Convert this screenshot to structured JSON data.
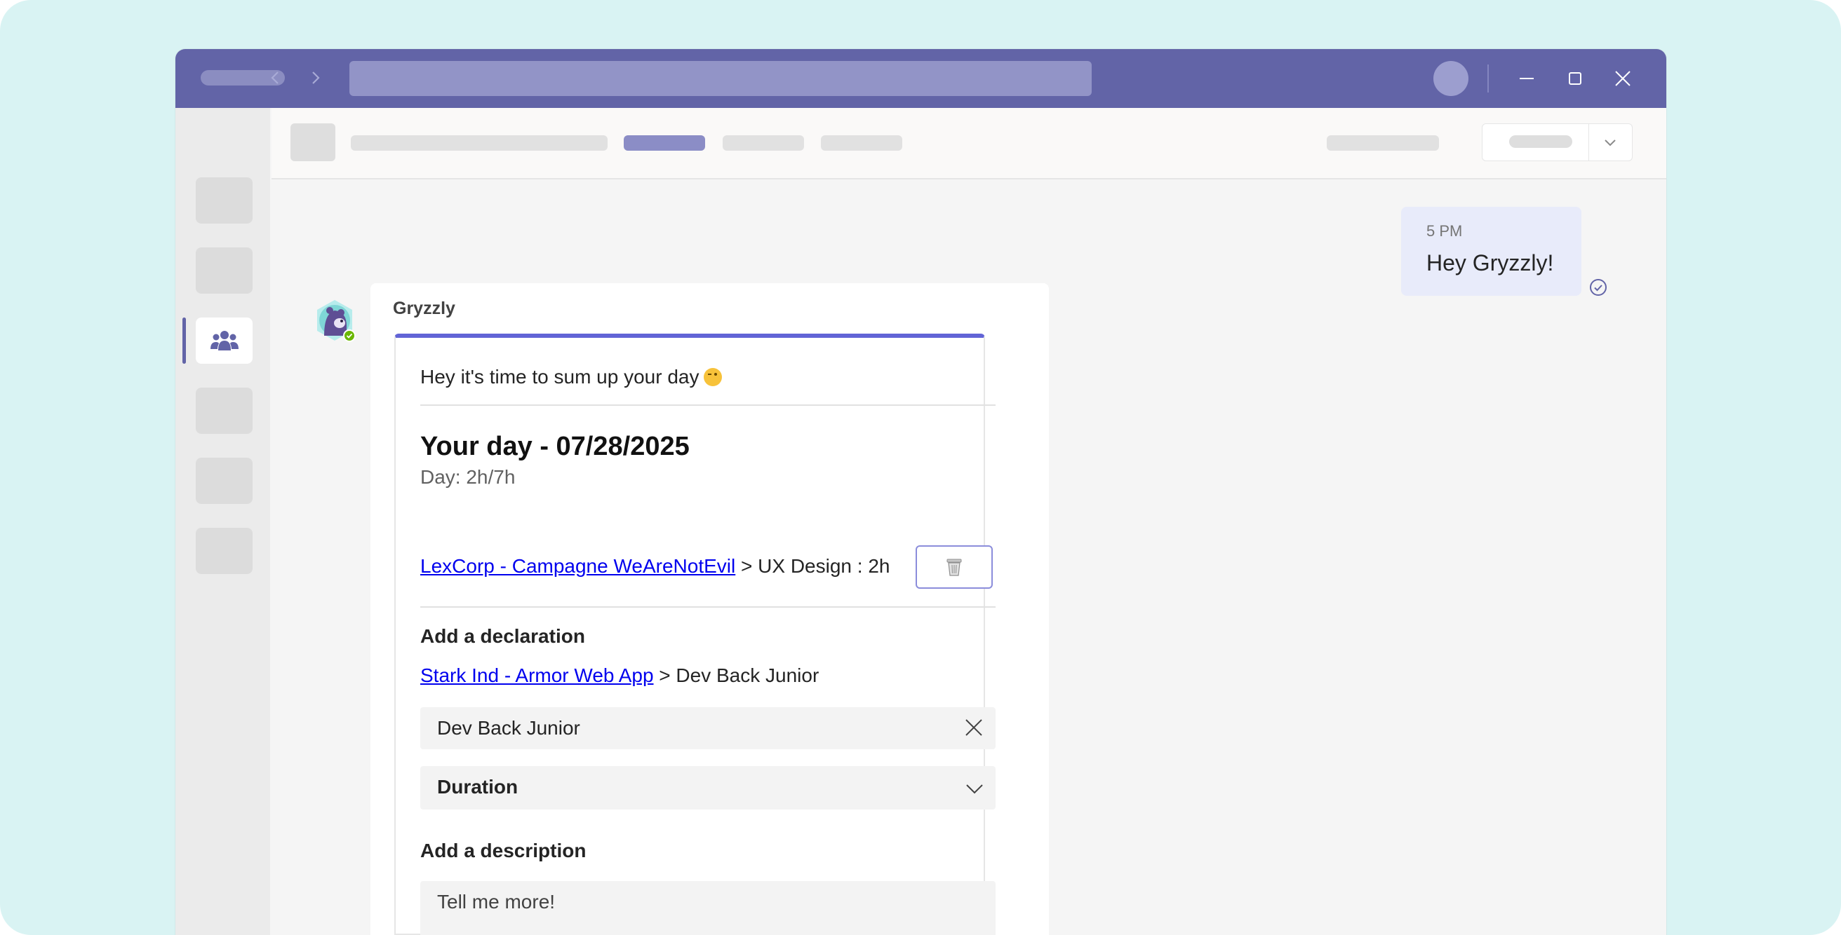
{
  "titlebar": {
    "back_icon": "chevron-left-icon",
    "forward_icon": "chevron-right-icon",
    "window_controls": [
      "minimize-icon",
      "maximize-icon",
      "close-icon"
    ]
  },
  "sidebar": {
    "active_index": 2,
    "active_icon": "teams-icon"
  },
  "chat": {
    "outgoing": {
      "time": "5 PM",
      "text": "Hey Gryzzly!",
      "status_icon": "read-check-icon"
    },
    "incoming": {
      "sender": "Gryzzly",
      "card": {
        "intro": "Hey it's time to sum up your day",
        "intro_emoji": "wink-emoji",
        "title": "Your day - 07/28/2025",
        "subtitle": "Day: 2h/7h",
        "entries": [
          {
            "project_link": "LexCorp - Campagne WeAreNotEvil",
            "detail": " > UX Design : 2h",
            "action_icon": "trash-icon"
          }
        ],
        "declaration": {
          "label": "Add a declaration",
          "project_link": "Stark Ind - Armor Web App",
          "project_detail": " > Dev Back Junior",
          "task_value": "Dev Back Junior",
          "duration_label": "Duration"
        },
        "description": {
          "label": "Add a description",
          "placeholder": "Tell me more!"
        }
      }
    }
  },
  "colors": {
    "titlebar": "#6264a7",
    "card_accent": "#6264d6",
    "bubble": "#e8ebfa",
    "backdrop": "#d9f3f3",
    "link": "#0000ee"
  }
}
